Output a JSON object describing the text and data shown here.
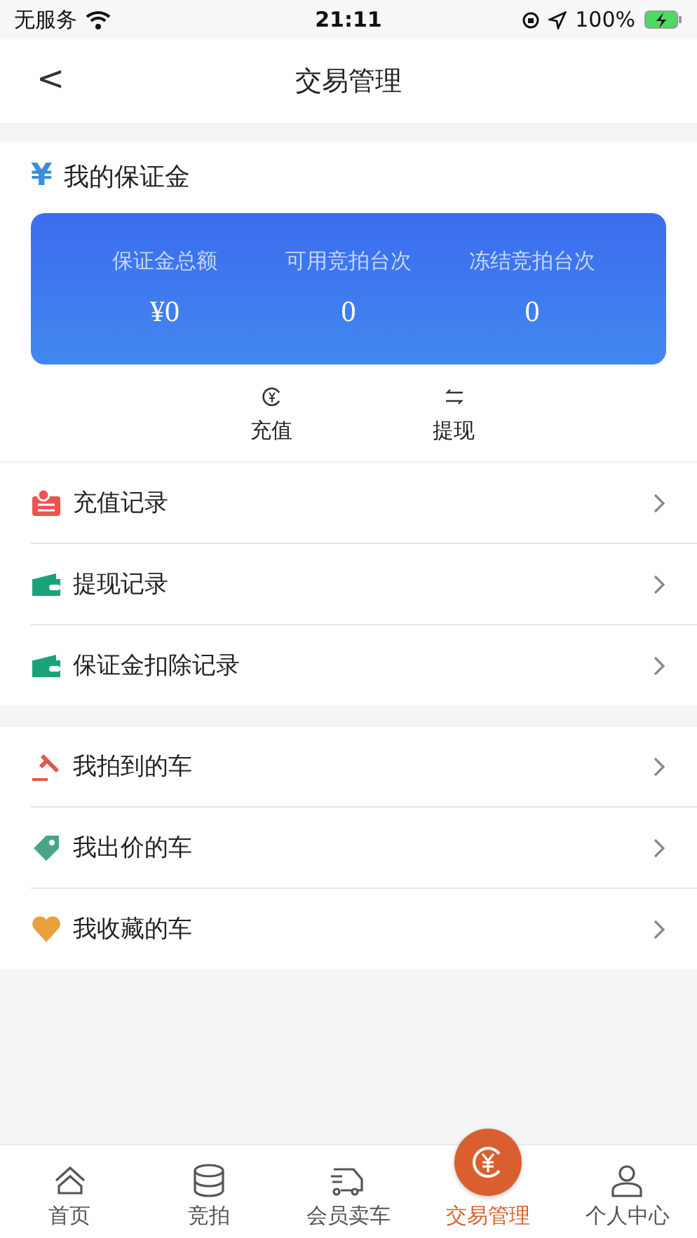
{
  "status_bar": {
    "carrier": "无服务",
    "time": "21:11",
    "battery": "100%"
  },
  "nav": {
    "back": "<",
    "title": "交易管理"
  },
  "deposit": {
    "title": "我的保证金",
    "symbol": "¥",
    "stats": [
      {
        "label": "保证金总额",
        "value": "¥0"
      },
      {
        "label": "可用竞拍台次",
        "value": "0"
      },
      {
        "label": "冻结竞拍台次",
        "value": "0"
      }
    ],
    "actions": [
      {
        "kind": "recharge",
        "label": "充值"
      },
      {
        "kind": "withdraw",
        "label": "提现"
      }
    ]
  },
  "menu_groups": [
    [
      {
        "kind": "receipt",
        "label": "充值记录"
      },
      {
        "kind": "wallet",
        "label": "提现记录"
      },
      {
        "kind": "wallet",
        "label": "保证金扣除记录"
      }
    ],
    [
      {
        "kind": "gavel",
        "label": "我拍到的车"
      },
      {
        "kind": "tag",
        "label": "我出价的车"
      },
      {
        "kind": "heart",
        "label": "我收藏的车"
      }
    ]
  ],
  "tab_bar": [
    {
      "kind": "home",
      "label": "首页",
      "selected": false
    },
    {
      "kind": "stack",
      "label": "竞拍",
      "selected": false
    },
    {
      "kind": "truck",
      "label": "会员卖车",
      "selected": false
    },
    {
      "kind": "money",
      "label": "交易管理",
      "selected": true
    },
    {
      "kind": "person",
      "label": "个人中心",
      "selected": false
    }
  ]
}
